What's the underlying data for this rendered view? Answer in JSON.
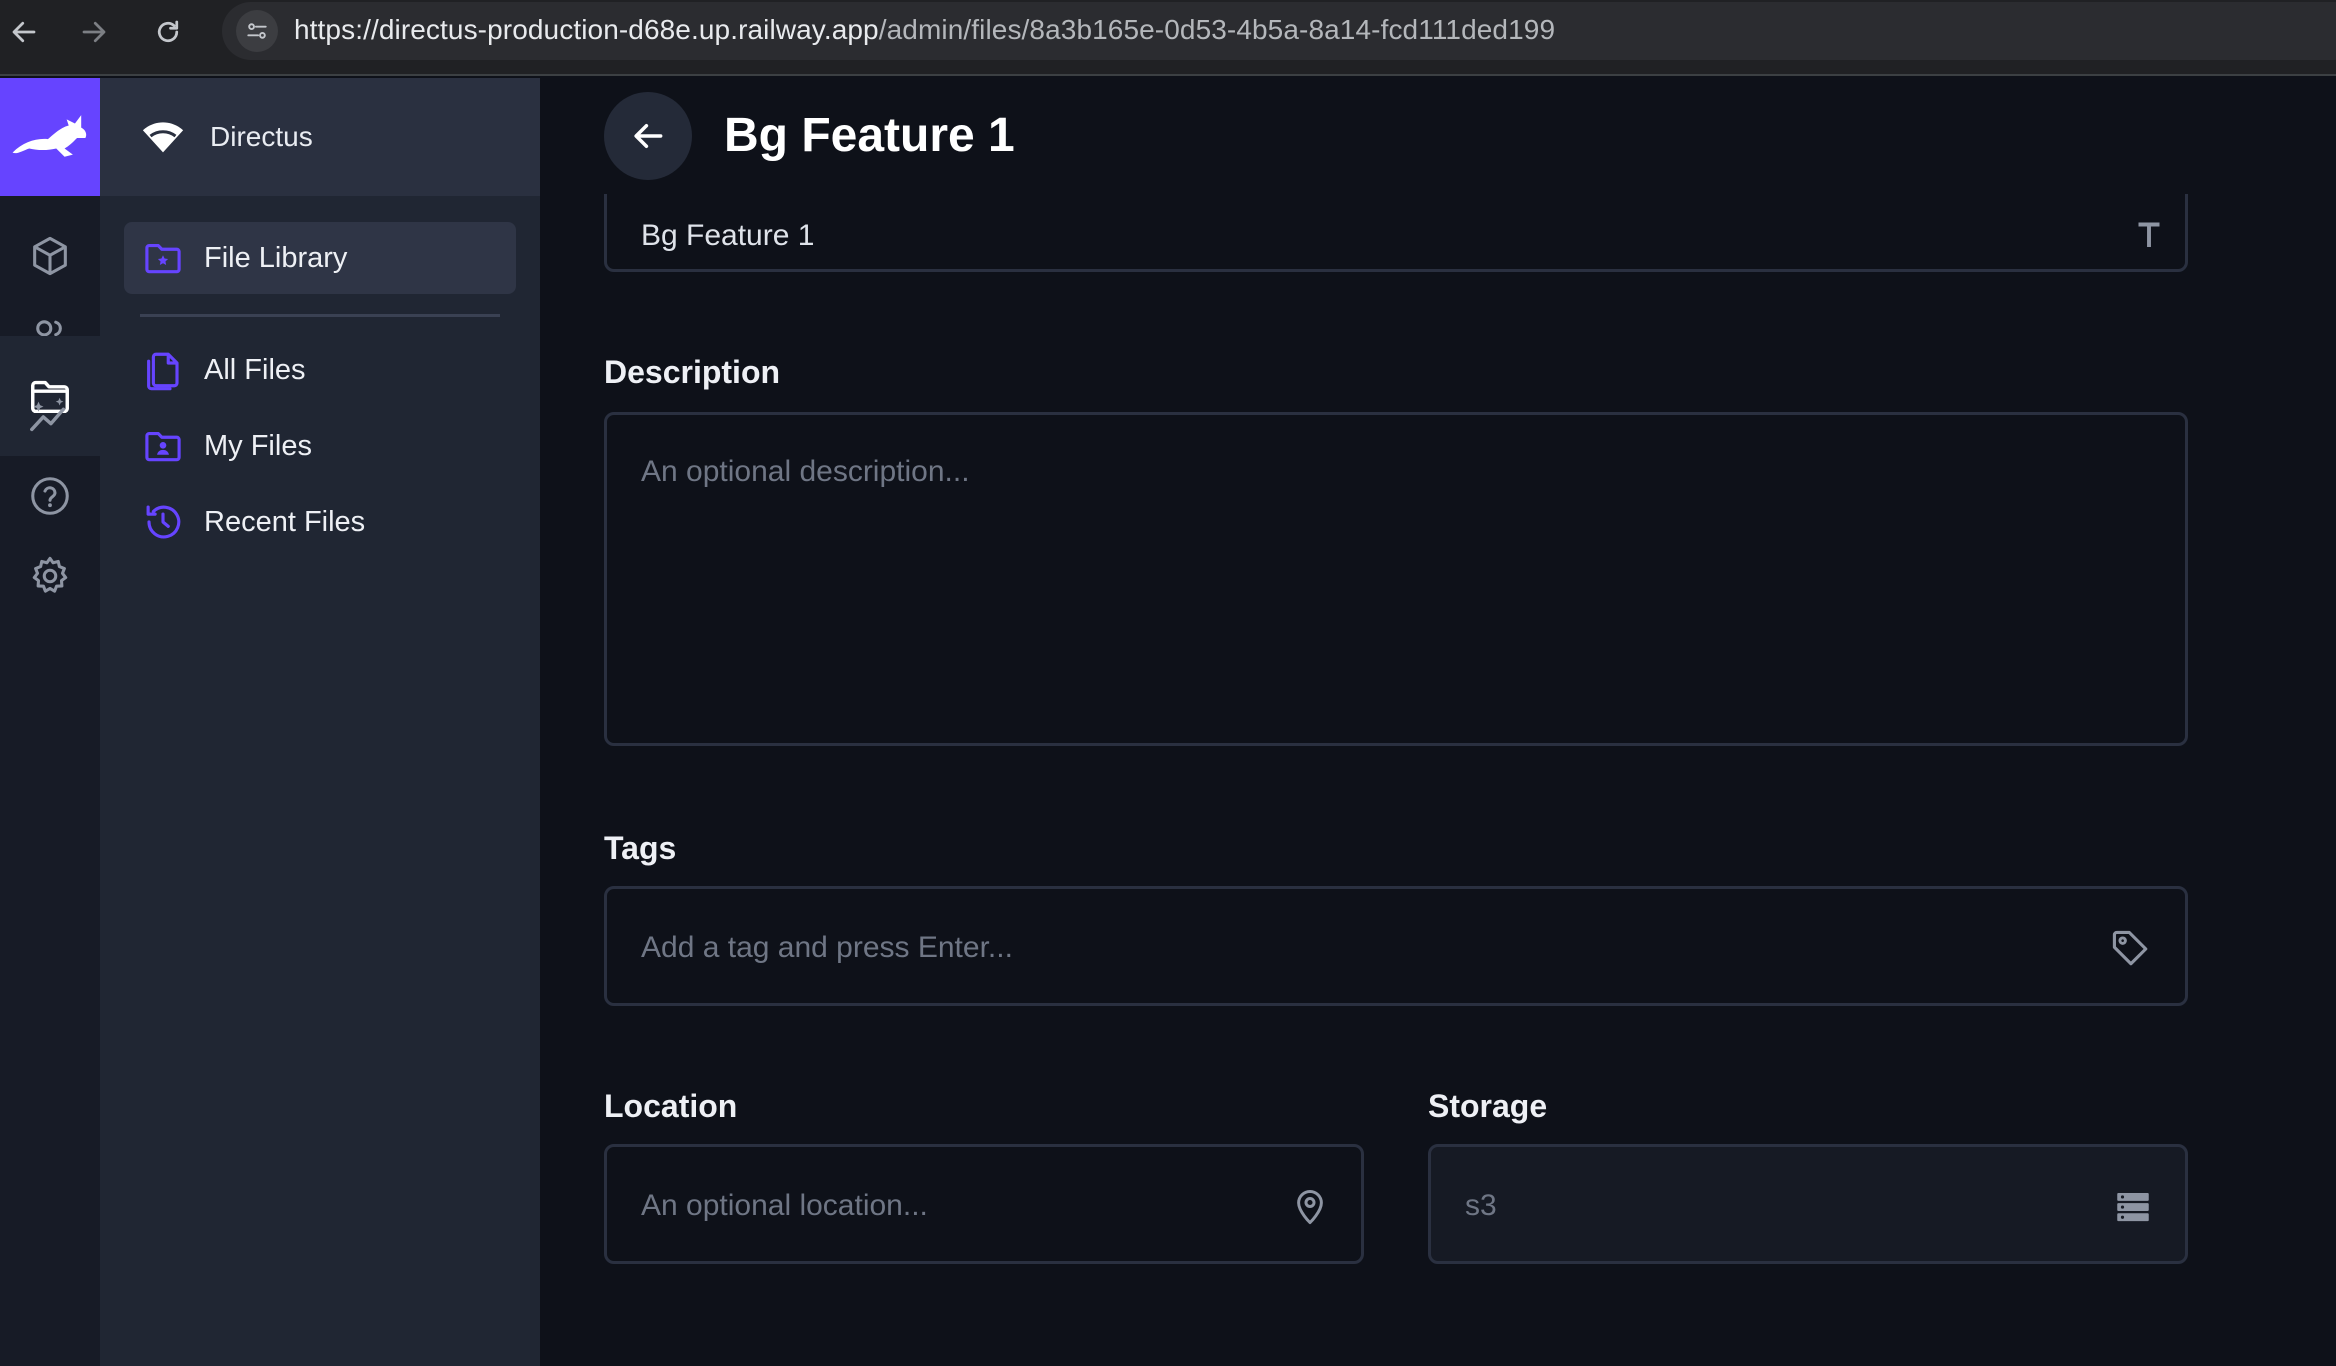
{
  "browser": {
    "url_host": "https://directus-production-d68e.up.railway.app",
    "url_path": "/admin/files/8a3b165e-0d53-4b5a-8a14-fcd111ded199"
  },
  "project": {
    "name": "Directus"
  },
  "nav": {
    "items": [
      {
        "label": "File Library"
      },
      {
        "label": "All Files"
      },
      {
        "label": "My Files"
      },
      {
        "label": "Recent Files"
      }
    ]
  },
  "page": {
    "title": "Bg Feature 1"
  },
  "form": {
    "title_value": "Bg Feature 1",
    "description": {
      "label": "Description",
      "placeholder": "An optional description..."
    },
    "tags": {
      "label": "Tags",
      "placeholder": "Add a tag and press Enter..."
    },
    "location": {
      "label": "Location",
      "placeholder": "An optional location..."
    },
    "storage": {
      "label": "Storage",
      "value": "s3"
    }
  },
  "colors": {
    "accent": "#6644ff",
    "icon_muted": "#8e95a3",
    "background": "#0e1119"
  }
}
